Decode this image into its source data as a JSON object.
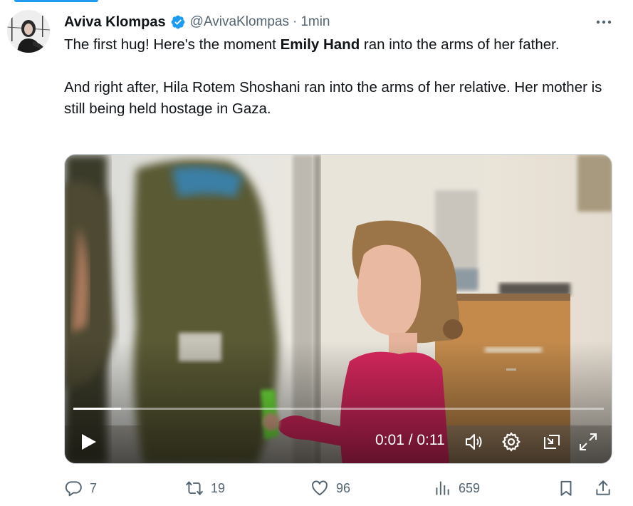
{
  "author": {
    "name": "Aviva Klompas",
    "handle": "@AvivaKlompas",
    "separator": "·",
    "time": "1min"
  },
  "tweet": {
    "line1_prefix": "The first hug! Here's the moment ",
    "line1_bold": "Emily Hand",
    "line1_suffix": " ran into the arms of her father.",
    "paragraph2": "And right after, Hila Rotem Shoshani ran into the arms of her relative. Her mother is still being held hostage in Gaza."
  },
  "video": {
    "time_display": "0:01 / 0:11",
    "progress": 0.09
  },
  "actions": {
    "replies": "7",
    "reposts": "19",
    "likes": "96",
    "views": "659"
  },
  "colors": {
    "accent": "#1d9bf0",
    "muted": "#536471",
    "text": "#0f1419"
  },
  "icons": [
    "verified-badge-icon",
    "more-icon",
    "play-icon",
    "volume-icon",
    "settings-icon",
    "minimize-icon",
    "fullscreen-icon",
    "reply-icon",
    "repost-icon",
    "like-icon",
    "views-icon",
    "bookmark-icon",
    "share-icon"
  ]
}
